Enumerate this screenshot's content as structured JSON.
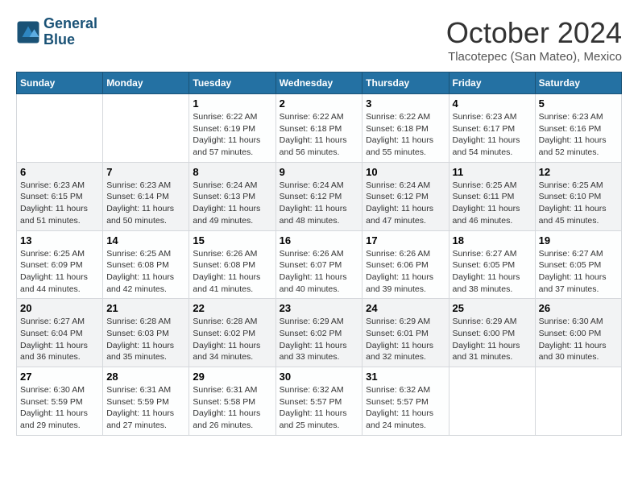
{
  "logo": {
    "line1": "General",
    "line2": "Blue"
  },
  "header": {
    "month": "October 2024",
    "location": "Tlacotepec (San Mateo), Mexico"
  },
  "days_of_week": [
    "Sunday",
    "Monday",
    "Tuesday",
    "Wednesday",
    "Thursday",
    "Friday",
    "Saturday"
  ],
  "weeks": [
    [
      {
        "day": "",
        "sunrise": "",
        "sunset": "",
        "daylight": ""
      },
      {
        "day": "",
        "sunrise": "",
        "sunset": "",
        "daylight": ""
      },
      {
        "day": "1",
        "sunrise": "Sunrise: 6:22 AM",
        "sunset": "Sunset: 6:19 PM",
        "daylight": "Daylight: 11 hours and 57 minutes."
      },
      {
        "day": "2",
        "sunrise": "Sunrise: 6:22 AM",
        "sunset": "Sunset: 6:18 PM",
        "daylight": "Daylight: 11 hours and 56 minutes."
      },
      {
        "day": "3",
        "sunrise": "Sunrise: 6:22 AM",
        "sunset": "Sunset: 6:18 PM",
        "daylight": "Daylight: 11 hours and 55 minutes."
      },
      {
        "day": "4",
        "sunrise": "Sunrise: 6:23 AM",
        "sunset": "Sunset: 6:17 PM",
        "daylight": "Daylight: 11 hours and 54 minutes."
      },
      {
        "day": "5",
        "sunrise": "Sunrise: 6:23 AM",
        "sunset": "Sunset: 6:16 PM",
        "daylight": "Daylight: 11 hours and 52 minutes."
      }
    ],
    [
      {
        "day": "6",
        "sunrise": "Sunrise: 6:23 AM",
        "sunset": "Sunset: 6:15 PM",
        "daylight": "Daylight: 11 hours and 51 minutes."
      },
      {
        "day": "7",
        "sunrise": "Sunrise: 6:23 AM",
        "sunset": "Sunset: 6:14 PM",
        "daylight": "Daylight: 11 hours and 50 minutes."
      },
      {
        "day": "8",
        "sunrise": "Sunrise: 6:24 AM",
        "sunset": "Sunset: 6:13 PM",
        "daylight": "Daylight: 11 hours and 49 minutes."
      },
      {
        "day": "9",
        "sunrise": "Sunrise: 6:24 AM",
        "sunset": "Sunset: 6:12 PM",
        "daylight": "Daylight: 11 hours and 48 minutes."
      },
      {
        "day": "10",
        "sunrise": "Sunrise: 6:24 AM",
        "sunset": "Sunset: 6:12 PM",
        "daylight": "Daylight: 11 hours and 47 minutes."
      },
      {
        "day": "11",
        "sunrise": "Sunrise: 6:25 AM",
        "sunset": "Sunset: 6:11 PM",
        "daylight": "Daylight: 11 hours and 46 minutes."
      },
      {
        "day": "12",
        "sunrise": "Sunrise: 6:25 AM",
        "sunset": "Sunset: 6:10 PM",
        "daylight": "Daylight: 11 hours and 45 minutes."
      }
    ],
    [
      {
        "day": "13",
        "sunrise": "Sunrise: 6:25 AM",
        "sunset": "Sunset: 6:09 PM",
        "daylight": "Daylight: 11 hours and 44 minutes."
      },
      {
        "day": "14",
        "sunrise": "Sunrise: 6:25 AM",
        "sunset": "Sunset: 6:08 PM",
        "daylight": "Daylight: 11 hours and 42 minutes."
      },
      {
        "day": "15",
        "sunrise": "Sunrise: 6:26 AM",
        "sunset": "Sunset: 6:08 PM",
        "daylight": "Daylight: 11 hours and 41 minutes."
      },
      {
        "day": "16",
        "sunrise": "Sunrise: 6:26 AM",
        "sunset": "Sunset: 6:07 PM",
        "daylight": "Daylight: 11 hours and 40 minutes."
      },
      {
        "day": "17",
        "sunrise": "Sunrise: 6:26 AM",
        "sunset": "Sunset: 6:06 PM",
        "daylight": "Daylight: 11 hours and 39 minutes."
      },
      {
        "day": "18",
        "sunrise": "Sunrise: 6:27 AM",
        "sunset": "Sunset: 6:05 PM",
        "daylight": "Daylight: 11 hours and 38 minutes."
      },
      {
        "day": "19",
        "sunrise": "Sunrise: 6:27 AM",
        "sunset": "Sunset: 6:05 PM",
        "daylight": "Daylight: 11 hours and 37 minutes."
      }
    ],
    [
      {
        "day": "20",
        "sunrise": "Sunrise: 6:27 AM",
        "sunset": "Sunset: 6:04 PM",
        "daylight": "Daylight: 11 hours and 36 minutes."
      },
      {
        "day": "21",
        "sunrise": "Sunrise: 6:28 AM",
        "sunset": "Sunset: 6:03 PM",
        "daylight": "Daylight: 11 hours and 35 minutes."
      },
      {
        "day": "22",
        "sunrise": "Sunrise: 6:28 AM",
        "sunset": "Sunset: 6:02 PM",
        "daylight": "Daylight: 11 hours and 34 minutes."
      },
      {
        "day": "23",
        "sunrise": "Sunrise: 6:29 AM",
        "sunset": "Sunset: 6:02 PM",
        "daylight": "Daylight: 11 hours and 33 minutes."
      },
      {
        "day": "24",
        "sunrise": "Sunrise: 6:29 AM",
        "sunset": "Sunset: 6:01 PM",
        "daylight": "Daylight: 11 hours and 32 minutes."
      },
      {
        "day": "25",
        "sunrise": "Sunrise: 6:29 AM",
        "sunset": "Sunset: 6:00 PM",
        "daylight": "Daylight: 11 hours and 31 minutes."
      },
      {
        "day": "26",
        "sunrise": "Sunrise: 6:30 AM",
        "sunset": "Sunset: 6:00 PM",
        "daylight": "Daylight: 11 hours and 30 minutes."
      }
    ],
    [
      {
        "day": "27",
        "sunrise": "Sunrise: 6:30 AM",
        "sunset": "Sunset: 5:59 PM",
        "daylight": "Daylight: 11 hours and 29 minutes."
      },
      {
        "day": "28",
        "sunrise": "Sunrise: 6:31 AM",
        "sunset": "Sunset: 5:59 PM",
        "daylight": "Daylight: 11 hours and 27 minutes."
      },
      {
        "day": "29",
        "sunrise": "Sunrise: 6:31 AM",
        "sunset": "Sunset: 5:58 PM",
        "daylight": "Daylight: 11 hours and 26 minutes."
      },
      {
        "day": "30",
        "sunrise": "Sunrise: 6:32 AM",
        "sunset": "Sunset: 5:57 PM",
        "daylight": "Daylight: 11 hours and 25 minutes."
      },
      {
        "day": "31",
        "sunrise": "Sunrise: 6:32 AM",
        "sunset": "Sunset: 5:57 PM",
        "daylight": "Daylight: 11 hours and 24 minutes."
      },
      {
        "day": "",
        "sunrise": "",
        "sunset": "",
        "daylight": ""
      },
      {
        "day": "",
        "sunrise": "",
        "sunset": "",
        "daylight": ""
      }
    ]
  ]
}
